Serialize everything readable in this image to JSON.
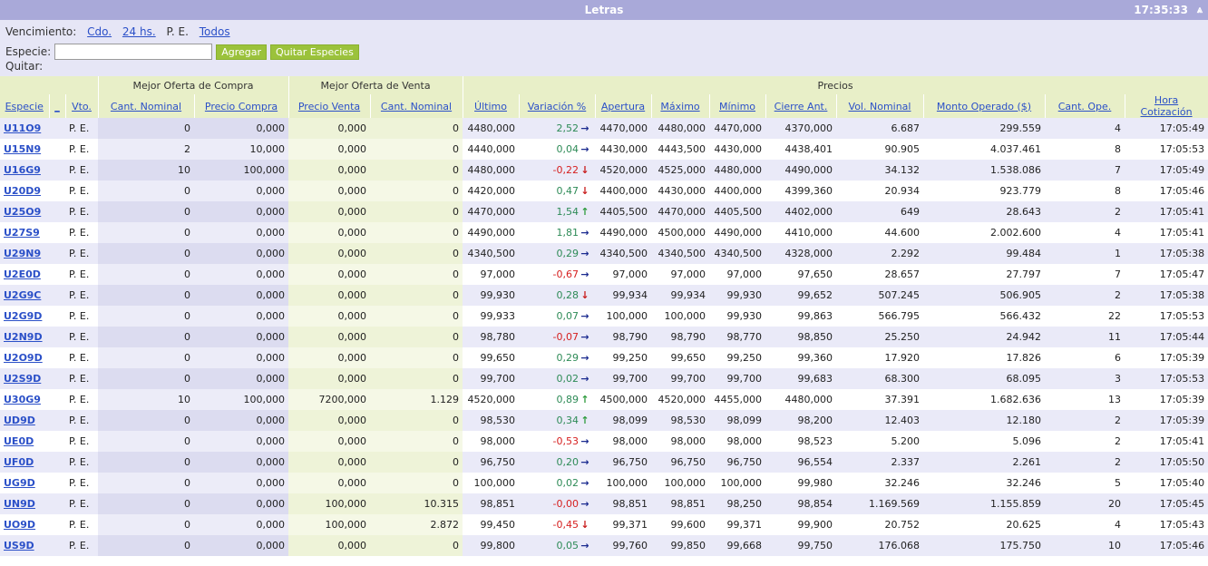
{
  "window": {
    "title": "Letras",
    "clock": "17:35:33"
  },
  "controls": {
    "vencimiento_label": "Vencimiento:",
    "venc_options": [
      "Cdo.",
      "24 hs."
    ],
    "venc_current": "P. E.",
    "venc_todos": "Todos",
    "especie_label": "Especie:",
    "especie_value": "",
    "agregar": "Agregar",
    "quitar_especies": "Quitar Especies",
    "quitar_label": "Quitar:"
  },
  "table": {
    "groups": {
      "compra": "Mejor Oferta de Compra",
      "venta": "Mejor Oferta de Venta",
      "precios": "Precios"
    },
    "columns": [
      "Especie",
      "_",
      "Vto.",
      "Cant. Nominal",
      "Precio Compra",
      "Precio Venta",
      "Cant. Nominal",
      "Último",
      "Variación %",
      "Apertura",
      "Máximo",
      "Mínimo",
      "Cierre Ant.",
      "Vol. Nominal",
      "Monto Operado ($)",
      "Cant. Ope.",
      "Hora Cotización"
    ],
    "rows": [
      {
        "esp": "U11O9",
        "vto": "P. E.",
        "cn_c": "0",
        "pc": "0,000",
        "pv": "0,000",
        "cn_v": "0",
        "ult": "4480,000",
        "var": "2,52",
        "dir": "right",
        "ape": "4470,000",
        "max": "4480,000",
        "min": "4470,000",
        "cie": "4370,000",
        "vol": "6.687",
        "monto": "299.559",
        "ope": "4",
        "hora": "17:05:49"
      },
      {
        "esp": "U15N9",
        "vto": "P. E.",
        "cn_c": "2",
        "pc": "10,000",
        "pv": "0,000",
        "cn_v": "0",
        "ult": "4440,000",
        "var": "0,04",
        "dir": "right",
        "ape": "4430,000",
        "max": "4443,500",
        "min": "4430,000",
        "cie": "4438,401",
        "vol": "90.905",
        "monto": "4.037.461",
        "ope": "8",
        "hora": "17:05:53"
      },
      {
        "esp": "U16G9",
        "vto": "P. E.",
        "cn_c": "10",
        "pc": "100,000",
        "pv": "0,000",
        "cn_v": "0",
        "ult": "4480,000",
        "var": "-0,22",
        "dir": "down",
        "ape": "4520,000",
        "max": "4525,000",
        "min": "4480,000",
        "cie": "4490,000",
        "vol": "34.132",
        "monto": "1.538.086",
        "ope": "7",
        "hora": "17:05:49"
      },
      {
        "esp": "U20D9",
        "vto": "P. E.",
        "cn_c": "0",
        "pc": "0,000",
        "pv": "0,000",
        "cn_v": "0",
        "ult": "4420,000",
        "var": "0,47",
        "dir": "down",
        "ape": "4400,000",
        "max": "4430,000",
        "min": "4400,000",
        "cie": "4399,360",
        "vol": "20.934",
        "monto": "923.779",
        "ope": "8",
        "hora": "17:05:46"
      },
      {
        "esp": "U25O9",
        "vto": "P. E.",
        "cn_c": "0",
        "pc": "0,000",
        "pv": "0,000",
        "cn_v": "0",
        "ult": "4470,000",
        "var": "1,54",
        "dir": "up",
        "ape": "4405,500",
        "max": "4470,000",
        "min": "4405,500",
        "cie": "4402,000",
        "vol": "649",
        "monto": "28.643",
        "ope": "2",
        "hora": "17:05:41"
      },
      {
        "esp": "U27S9",
        "vto": "P. E.",
        "cn_c": "0",
        "pc": "0,000",
        "pv": "0,000",
        "cn_v": "0",
        "ult": "4490,000",
        "var": "1,81",
        "dir": "right",
        "ape": "4490,000",
        "max": "4500,000",
        "min": "4490,000",
        "cie": "4410,000",
        "vol": "44.600",
        "monto": "2.002.600",
        "ope": "4",
        "hora": "17:05:41"
      },
      {
        "esp": "U29N9",
        "vto": "P. E.",
        "cn_c": "0",
        "pc": "0,000",
        "pv": "0,000",
        "cn_v": "0",
        "ult": "4340,500",
        "var": "0,29",
        "dir": "right",
        "ape": "4340,500",
        "max": "4340,500",
        "min": "4340,500",
        "cie": "4328,000",
        "vol": "2.292",
        "monto": "99.484",
        "ope": "1",
        "hora": "17:05:38"
      },
      {
        "esp": "U2E0D",
        "vto": "P. E.",
        "cn_c": "0",
        "pc": "0,000",
        "pv": "0,000",
        "cn_v": "0",
        "ult": "97,000",
        "var": "-0,67",
        "dir": "right",
        "ape": "97,000",
        "max": "97,000",
        "min": "97,000",
        "cie": "97,650",
        "vol": "28.657",
        "monto": "27.797",
        "ope": "7",
        "hora": "17:05:47"
      },
      {
        "esp": "U2G9C",
        "vto": "P. E.",
        "cn_c": "0",
        "pc": "0,000",
        "pv": "0,000",
        "cn_v": "0",
        "ult": "99,930",
        "var": "0,28",
        "dir": "down",
        "ape": "99,934",
        "max": "99,934",
        "min": "99,930",
        "cie": "99,652",
        "vol": "507.245",
        "monto": "506.905",
        "ope": "2",
        "hora": "17:05:38"
      },
      {
        "esp": "U2G9D",
        "vto": "P. E.",
        "cn_c": "0",
        "pc": "0,000",
        "pv": "0,000",
        "cn_v": "0",
        "ult": "99,933",
        "var": "0,07",
        "dir": "right",
        "ape": "100,000",
        "max": "100,000",
        "min": "99,930",
        "cie": "99,863",
        "vol": "566.795",
        "monto": "566.432",
        "ope": "22",
        "hora": "17:05:53"
      },
      {
        "esp": "U2N9D",
        "vto": "P. E.",
        "cn_c": "0",
        "pc": "0,000",
        "pv": "0,000",
        "cn_v": "0",
        "ult": "98,780",
        "var": "-0,07",
        "dir": "right",
        "ape": "98,790",
        "max": "98,790",
        "min": "98,770",
        "cie": "98,850",
        "vol": "25.250",
        "monto": "24.942",
        "ope": "11",
        "hora": "17:05:44"
      },
      {
        "esp": "U2O9D",
        "vto": "P. E.",
        "cn_c": "0",
        "pc": "0,000",
        "pv": "0,000",
        "cn_v": "0",
        "ult": "99,650",
        "var": "0,29",
        "dir": "right",
        "ape": "99,250",
        "max": "99,650",
        "min": "99,250",
        "cie": "99,360",
        "vol": "17.920",
        "monto": "17.826",
        "ope": "6",
        "hora": "17:05:39"
      },
      {
        "esp": "U2S9D",
        "vto": "P. E.",
        "cn_c": "0",
        "pc": "0,000",
        "pv": "0,000",
        "cn_v": "0",
        "ult": "99,700",
        "var": "0,02",
        "dir": "right",
        "ape": "99,700",
        "max": "99,700",
        "min": "99,700",
        "cie": "99,683",
        "vol": "68.300",
        "monto": "68.095",
        "ope": "3",
        "hora": "17:05:53"
      },
      {
        "esp": "U30G9",
        "vto": "P. E.",
        "cn_c": "10",
        "pc": "100,000",
        "pv": "7200,000",
        "cn_v": "1.129",
        "ult": "4520,000",
        "var": "0,89",
        "dir": "up",
        "ape": "4500,000",
        "max": "4520,000",
        "min": "4455,000",
        "cie": "4480,000",
        "vol": "37.391",
        "monto": "1.682.636",
        "ope": "13",
        "hora": "17:05:39"
      },
      {
        "esp": "UD9D",
        "vto": "P. E.",
        "cn_c": "0",
        "pc": "0,000",
        "pv": "0,000",
        "cn_v": "0",
        "ult": "98,530",
        "var": "0,34",
        "dir": "up",
        "ape": "98,099",
        "max": "98,530",
        "min": "98,099",
        "cie": "98,200",
        "vol": "12.403",
        "monto": "12.180",
        "ope": "2",
        "hora": "17:05:39"
      },
      {
        "esp": "UE0D",
        "vto": "P. E.",
        "cn_c": "0",
        "pc": "0,000",
        "pv": "0,000",
        "cn_v": "0",
        "ult": "98,000",
        "var": "-0,53",
        "dir": "right",
        "ape": "98,000",
        "max": "98,000",
        "min": "98,000",
        "cie": "98,523",
        "vol": "5.200",
        "monto": "5.096",
        "ope": "2",
        "hora": "17:05:41"
      },
      {
        "esp": "UF0D",
        "vto": "P. E.",
        "cn_c": "0",
        "pc": "0,000",
        "pv": "0,000",
        "cn_v": "0",
        "ult": "96,750",
        "var": "0,20",
        "dir": "right",
        "ape": "96,750",
        "max": "96,750",
        "min": "96,750",
        "cie": "96,554",
        "vol": "2.337",
        "monto": "2.261",
        "ope": "2",
        "hora": "17:05:50"
      },
      {
        "esp": "UG9D",
        "vto": "P. E.",
        "cn_c": "0",
        "pc": "0,000",
        "pv": "0,000",
        "cn_v": "0",
        "ult": "100,000",
        "var": "0,02",
        "dir": "right",
        "ape": "100,000",
        "max": "100,000",
        "min": "100,000",
        "cie": "99,980",
        "vol": "32.246",
        "monto": "32.246",
        "ope": "5",
        "hora": "17:05:40"
      },
      {
        "esp": "UN9D",
        "vto": "P. E.",
        "cn_c": "0",
        "pc": "0,000",
        "pv": "100,000",
        "cn_v": "10.315",
        "ult": "98,851",
        "var": "-0,00",
        "dir": "right",
        "ape": "98,851",
        "max": "98,851",
        "min": "98,250",
        "cie": "98,854",
        "vol": "1.169.569",
        "monto": "1.155.859",
        "ope": "20",
        "hora": "17:05:45"
      },
      {
        "esp": "UO9D",
        "vto": "P. E.",
        "cn_c": "0",
        "pc": "0,000",
        "pv": "100,000",
        "cn_v": "2.872",
        "ult": "99,450",
        "var": "-0,45",
        "dir": "down",
        "ape": "99,371",
        "max": "99,600",
        "min": "99,371",
        "cie": "99,900",
        "vol": "20.752",
        "monto": "20.625",
        "ope": "4",
        "hora": "17:05:43"
      },
      {
        "esp": "US9D",
        "vto": "P. E.",
        "cn_c": "0",
        "pc": "0,000",
        "pv": "0,000",
        "cn_v": "0",
        "ult": "99,800",
        "var": "0,05",
        "dir": "right",
        "ape": "99,760",
        "max": "99,850",
        "min": "99,668",
        "cie": "99,750",
        "vol": "176.068",
        "monto": "175.750",
        "ope": "10",
        "hora": "17:05:46"
      }
    ]
  }
}
